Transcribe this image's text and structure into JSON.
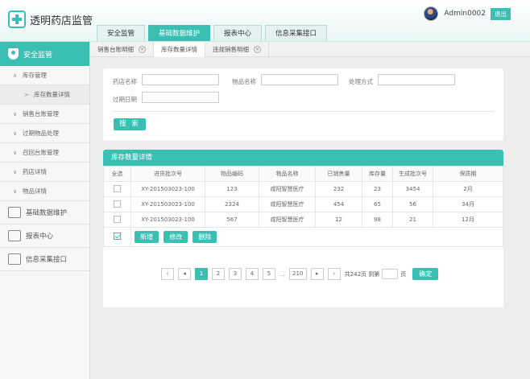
{
  "app": {
    "title": "透明药店监管"
  },
  "user": {
    "name": "Admin0002",
    "logout": "退出"
  },
  "top_tabs": [
    "安全监管",
    "基础数据维护",
    "报表中心",
    "信息采集接口"
  ],
  "sidebar": {
    "head": "安全监管",
    "items": [
      {
        "label": "库存管理",
        "chev": "∧"
      },
      {
        "label": "库存数量详情",
        "chev": ">",
        "sub": true
      },
      {
        "label": "销售台账管理",
        "chev": "∨"
      },
      {
        "label": "过期物品处理",
        "chev": "∨"
      },
      {
        "label": "召回台账管理",
        "chev": "∨"
      },
      {
        "label": "药店详情",
        "chev": "∨"
      },
      {
        "label": "物品详情",
        "chev": "∨"
      }
    ],
    "big_items": [
      "基础数据维护",
      "报表中心",
      "信息采集接口"
    ]
  },
  "content_tabs": [
    {
      "label": "销售台账明细",
      "close": "×"
    },
    {
      "label": "库存数量详情",
      "close": ""
    },
    {
      "label": "违规销售明细",
      "close": "×"
    }
  ],
  "filter": {
    "store_label": "药店名称",
    "item_label": "物品名称",
    "method_label": "处理方式",
    "expiry_label": "过期日期",
    "search": "搜 索"
  },
  "panel": {
    "title": "库存数量详情",
    "columns": [
      "全选",
      "进货批次号",
      "物品编码",
      "物品名称",
      "已销售量",
      "库存量",
      "生成批次号",
      "保质期"
    ],
    "rows": [
      [
        "XY-201503023-100",
        "123",
        "咸阳智慧医疗",
        "232",
        "23",
        "3454",
        "2月"
      ],
      [
        "XY-201503023-100",
        "2324",
        "咸阳智慧医疗",
        "454",
        "65",
        "56",
        "34月"
      ],
      [
        "XY-201503023-100",
        "567",
        "咸阳智慧医疗",
        "12",
        "98",
        "21",
        "12月"
      ]
    ],
    "actions": [
      "新增",
      "修改",
      "删除"
    ]
  },
  "pager": {
    "first": "‹",
    "prev": "◂",
    "pages": [
      "1",
      "2",
      "3",
      "4",
      "5"
    ],
    "dots": "...",
    "last_page": "210",
    "next": "▸",
    "end": "›",
    "total_text": "共242页 到第",
    "page_unit": "页",
    "ok": "确定"
  }
}
